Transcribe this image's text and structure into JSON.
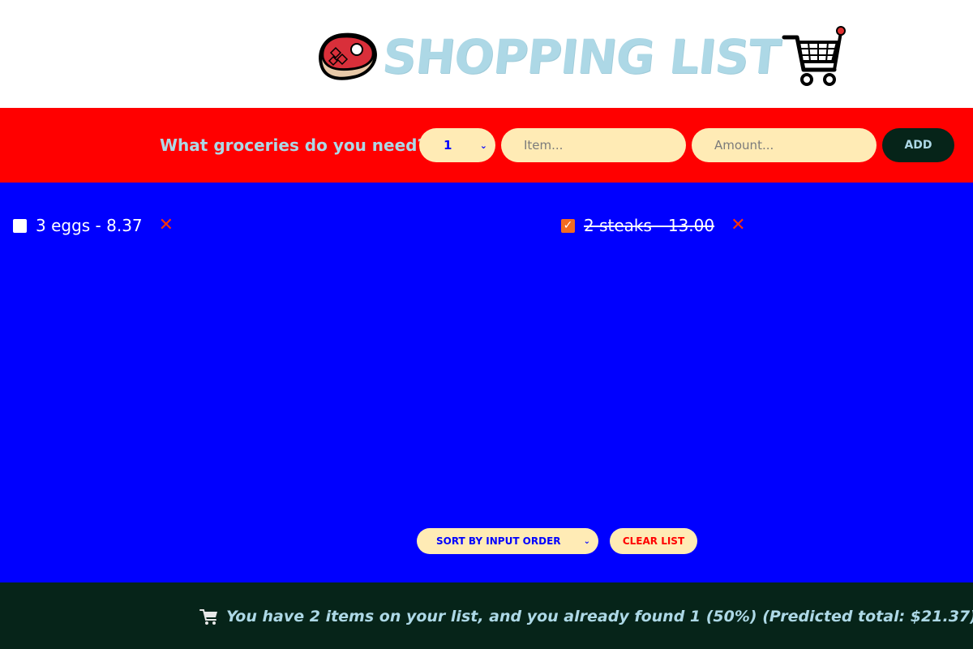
{
  "app": {
    "title": "SHOPPING LIST",
    "logo_left_icon": "steak-icon",
    "logo_right_icon": "shopping-cart-icon"
  },
  "form": {
    "question": "What groceries do you need?",
    "quantity_value": "1",
    "item_placeholder": "Item...",
    "amount_placeholder": "Amount...",
    "add_label": "ADD"
  },
  "items": [
    {
      "text": "3 eggs - 8.37",
      "checked": false
    },
    {
      "text": "2 steaks - 13.00",
      "checked": true
    }
  ],
  "controls": {
    "sort_value": "SORT BY INPUT ORDER",
    "clear_label": "CLEAR LIST"
  },
  "footer": {
    "icon": "shopping-cart-icon",
    "summary": "You have 2 items on your list, and you already found 1 (50%) (Predicted total: $21.37)"
  },
  "colors": {
    "header_bg": "#ffffff",
    "form_bg": "#ff0000",
    "main_bg": "#0000ff",
    "footer_bg": "#062419",
    "title_color": "#add8e6",
    "pill_bg": "#ffebb5",
    "checked_box": "#f26b21"
  }
}
